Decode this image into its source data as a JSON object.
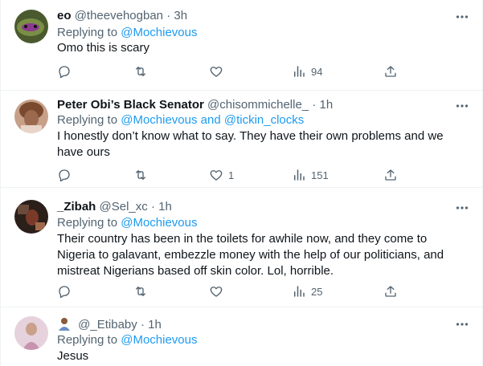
{
  "tweets": [
    {
      "name": "eo",
      "handle": "@theevehogban",
      "sep": "·",
      "time": "3h",
      "replying_prefix": "Replying to",
      "replying_to": "@Mochievous",
      "text": "Omo this is scary",
      "replies": "",
      "retweets": "",
      "likes": "",
      "views": "94",
      "avatar_color": "#5a6b3a"
    },
    {
      "name": "Peter Obi’s Black Senator",
      "handle": "@chisommichelle_",
      "sep": "·",
      "time": "1h",
      "replying_prefix": "Replying to",
      "replying_to": "@Mochievous and @tickin_clocks",
      "text": "I honestly don’t know what to say. They have their own problems and we have ours",
      "replies": "",
      "retweets": "",
      "likes": "1",
      "views": "151",
      "avatar_color": "#b9876a"
    },
    {
      "name": "_Zibah",
      "handle": "@Sel_xc",
      "sep": "·",
      "time": "1h",
      "replying_prefix": "Replying to",
      "replying_to": "@Mochievous",
      "text": "Their country has been in the toilets for awhile now, and they come to Nigeria to galavant, embezzle money with the help of our politicians, and mistreat Nigerians based off skin color. Lol, horrible.",
      "replies": "",
      "retweets": "",
      "likes": "",
      "views": "25",
      "avatar_color": "#3a2a22"
    },
    {
      "name": "",
      "handle": "@_Etibaby",
      "sep": "·",
      "time": "1h",
      "replying_prefix": "Replying to",
      "replying_to": "@Mochievous",
      "text": "Jesus",
      "avatar_color": "#d9b8c8"
    }
  ],
  "colors": {
    "link": "#1d9bf0",
    "muted": "#536471",
    "text": "#0f1419",
    "divider": "#eff3f4"
  },
  "icons": [
    "reply-icon",
    "retweet-icon",
    "like-icon",
    "views-icon",
    "share-icon",
    "more-icon"
  ]
}
